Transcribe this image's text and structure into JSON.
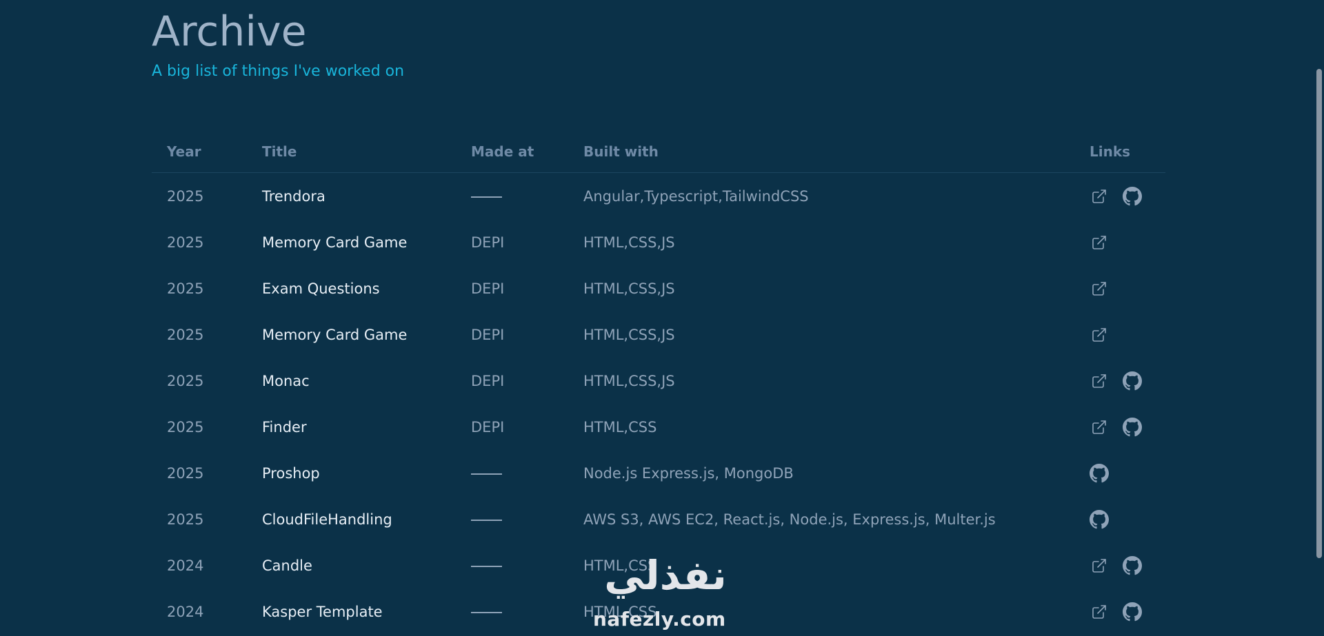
{
  "header": {
    "title": "Archive",
    "subtitle": "A big list of things I've worked on"
  },
  "table": {
    "columns": [
      "Year",
      "Title",
      "Made at",
      "Built with",
      "Links"
    ],
    "rows": [
      {
        "year": "2025",
        "title": "Trendora",
        "made_at": "",
        "built_with": "Angular,Typescript,TailwindCSS",
        "links": [
          "external-link-icon",
          "github-icon"
        ]
      },
      {
        "year": "2025",
        "title": "Memory Card Game",
        "made_at": "DEPI",
        "built_with": "HTML,CSS,JS",
        "links": [
          "external-link-icon"
        ]
      },
      {
        "year": "2025",
        "title": "Exam Questions",
        "made_at": "DEPI",
        "built_with": "HTML,CSS,JS",
        "links": [
          "external-link-icon"
        ]
      },
      {
        "year": "2025",
        "title": "Memory Card Game",
        "made_at": "DEPI",
        "built_with": "HTML,CSS,JS",
        "links": [
          "external-link-icon"
        ]
      },
      {
        "year": "2025",
        "title": "Monac",
        "made_at": "DEPI",
        "built_with": "HTML,CSS,JS",
        "links": [
          "external-link-icon",
          "github-icon"
        ]
      },
      {
        "year": "2025",
        "title": "Finder",
        "made_at": "DEPI",
        "built_with": "HTML,CSS",
        "links": [
          "external-link-icon",
          "github-icon"
        ]
      },
      {
        "year": "2025",
        "title": "Proshop",
        "made_at": "",
        "built_with": "Node.js Express.js, MongoDB",
        "links": [
          "github-icon"
        ]
      },
      {
        "year": "2025",
        "title": "CloudFileHandling",
        "made_at": "",
        "built_with": "AWS S3, AWS EC2, React.js, Node.js, Express.js, Multer.js",
        "links": [
          "github-icon"
        ]
      },
      {
        "year": "2024",
        "title": "Candle",
        "made_at": "",
        "built_with": "HTML,CSS",
        "links": [
          "external-link-icon",
          "github-icon"
        ]
      },
      {
        "year": "2024",
        "title": "Kasper Template",
        "made_at": "",
        "built_with": "HTML,CSS",
        "links": [
          "external-link-icon",
          "github-icon"
        ]
      }
    ]
  },
  "watermark": {
    "arabic": "نفذلي",
    "latin": "nafezly.com"
  },
  "colors": {
    "background": "#0b3148",
    "title": "#9fb3c8",
    "accent": "#19b5db",
    "muted": "#8fa3b8",
    "heading": "#6f8aa6",
    "text": "#e7eef5"
  }
}
